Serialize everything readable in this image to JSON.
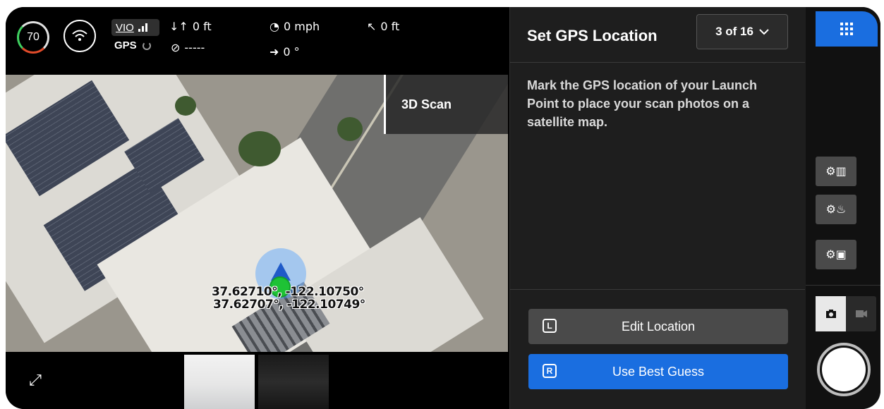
{
  "telemetry": {
    "battery_percent": "70",
    "vio_label": "VIO",
    "gps_label": "GPS",
    "altitude": "0 ft",
    "speed": "0 mph",
    "distance": "0 ft",
    "heading": "-----",
    "gimbal": "0 °"
  },
  "map": {
    "mode_label": "3D Scan",
    "coord_line_1": "37.62710°, -122.10750°",
    "coord_line_2": "37.62707°, -122.10749°",
    "info_icon": "i"
  },
  "panel": {
    "title": "Set GPS Location",
    "step_selector": "3 of 16",
    "description": "Mark the GPS location of your Launch Point to place your scan photos on a satellite map.",
    "edit_button": "Edit Location",
    "edit_key": "L",
    "guess_button": "Use Best Guess",
    "guess_key": "R"
  },
  "colors": {
    "accent_blue": "#1a6ee0",
    "pin_green": "#1ec235",
    "panel_bg": "#1e1e1e"
  },
  "icons": [
    "apps-grid-icon",
    "map-settings-icon",
    "fire-settings-icon",
    "camera-settings-icon",
    "camera-icon",
    "video-icon",
    "expand-icon",
    "wifi-icon",
    "speed-icon",
    "compass-icon",
    "gimbal-icon"
  ]
}
